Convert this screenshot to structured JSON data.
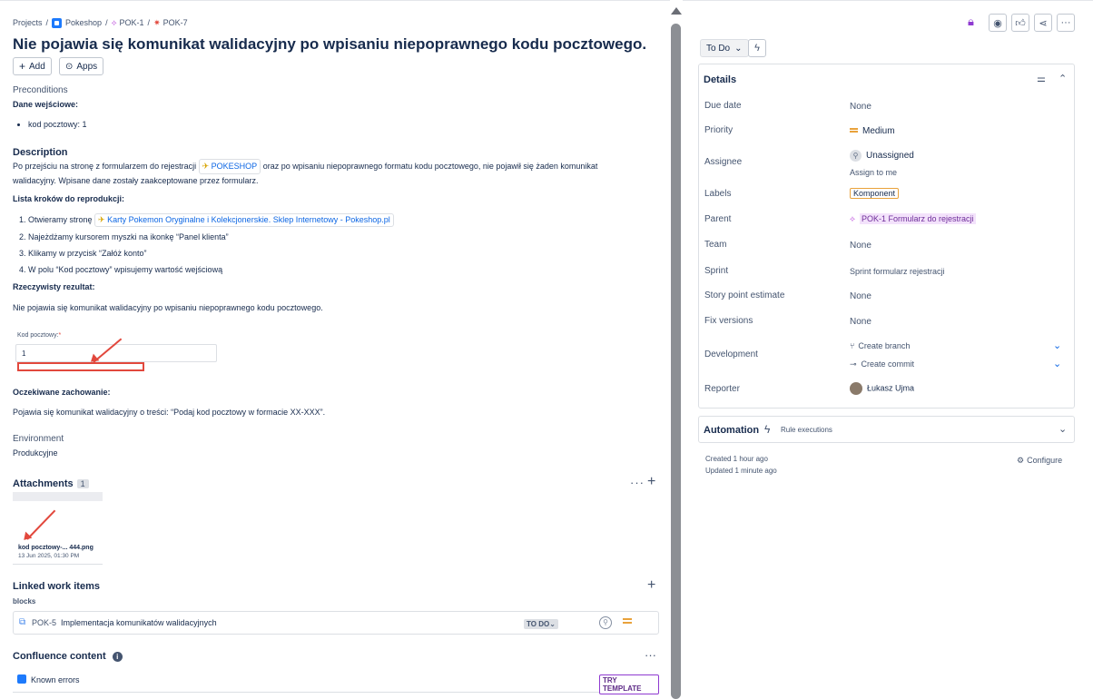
{
  "breadcrumb": {
    "projects": "Projects",
    "project": "Pokeshop",
    "parent": "POK-1",
    "current": "POK-7"
  },
  "issue": {
    "title": "Nie pojawia się komunikat walidacyjny po wpisaniu niepoprawnego kodu pocztowego.",
    "add_button": "Add",
    "apps_button": "Apps"
  },
  "preconditions": {
    "label": "Preconditions",
    "heading": "Dane wejściowe:",
    "items": [
      "kod pocztowy: 1"
    ]
  },
  "description": {
    "label": "Description",
    "para_before_link": "Po przejściu na stronę z formularzem do rejestracji",
    "inline_link": "POKESHOP",
    "para_after_link": "oraz po wpisaniu niepoprawnego formatu kodu pocztowego, nie pojawił się żaden komunikat",
    "para_line2": "walidacyjny. Wpisane dane zostały zaakceptowane przez formularz.",
    "steps_heading": "Lista kroków do reprodukcji:",
    "step1_text": "Otwieramy stronę",
    "step1_link": "Karty Pokemon Oryginalne i Kolekcjonerskie. Sklep Internetowy - Pokeshop.pl",
    "step2": "Najeżdżamy kursorem myszki na ikonkę “Panel klienta”",
    "step3": "Klikamy w przycisk “Załóż konto”",
    "step4": "W polu “Kod pocztowy” wpisujemy wartość wejściową",
    "actual_heading": "Rzeczywisty rezultat:",
    "actual_text": "Nie pojawia się komunikat walidacyjny po wpisaniu niepoprawnego kodu pocztowego.",
    "form_label": "Kod pocztowy:",
    "form_required": "*",
    "form_value": "1",
    "expected_heading": "Oczekiwane zachowanie:",
    "expected_text": "Pojawia się komunikat walidacyjny o treści: “Podaj kod pocztowy w formacie XX-XXX”."
  },
  "environment": {
    "label": "Environment",
    "value": "Produkcyjne"
  },
  "attachments": {
    "label": "Attachments",
    "count": "1",
    "file_name": "kod pocztowy-... 444.png",
    "file_date": "13 Jun 2025, 01:30 PM"
  },
  "linked": {
    "label": "Linked work items",
    "relation": "blocks",
    "key": "POK-5",
    "summary": "Implementacja komunikatów walidacyjnych",
    "status": "TO DO"
  },
  "confluence": {
    "label": "Confluence content",
    "item": "Known errors",
    "try_template": "TRY TEMPLATE"
  },
  "sidebar": {
    "status_button": "To Do",
    "details_title": "Details",
    "fields": {
      "due_date": {
        "label": "Due date",
        "value": "None"
      },
      "priority": {
        "label": "Priority",
        "value": "Medium"
      },
      "assignee": {
        "label": "Assignee",
        "value": "Unassigned",
        "action": "Assign to me"
      },
      "labels": {
        "label": "Labels",
        "value": "Komponent"
      },
      "parent": {
        "label": "Parent",
        "value": "POK-1 Formularz do rejestracji"
      },
      "team": {
        "label": "Team",
        "value": "None"
      },
      "sprint": {
        "label": "Sprint",
        "value": "Sprint formularz rejestracji"
      },
      "story_points": {
        "label": "Story point estimate",
        "value": "None"
      },
      "fix_versions": {
        "label": "Fix versions",
        "value": "None"
      },
      "development": {
        "label": "Development",
        "create_branch": "Create branch",
        "create_commit": "Create commit"
      },
      "reporter": {
        "label": "Reporter",
        "value": "Łukasz Ujma"
      }
    },
    "automation_title": "Automation",
    "rule_executions": "Rule executions",
    "created": "Created 1 hour ago",
    "updated": "Updated 1 minute ago",
    "configure": "Configure"
  },
  "colors": {
    "link": "#0c66e4",
    "annotation_red": "#e2483d",
    "priority_medium": "#e9a23b",
    "label_border": "#e9a23b",
    "parent_bg": "#f3e2fb"
  }
}
